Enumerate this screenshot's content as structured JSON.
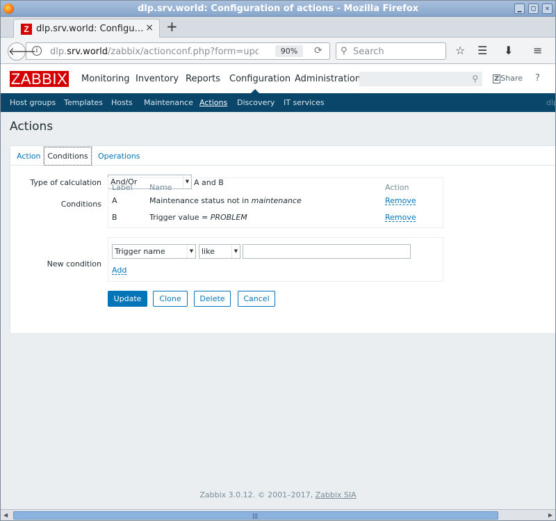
{
  "window": {
    "title": "dlp.srv.world: Configuration of actions - Mozilla Firefox",
    "btn_min": "▁",
    "btn_max": "□",
    "btn_close": "✕"
  },
  "browser": {
    "tab_title": "dlp.srv.world: Configu…",
    "tab_close": "×",
    "new_tab": "+",
    "url_host": "dlp.srv.world",
    "url_prefix": "dlp.",
    "url_domain": "srv.world",
    "url_path": "/zabbix/actionconf.php?form=upc",
    "zoom": "90%",
    "search_placeholder": "Search"
  },
  "zabbix": {
    "logo": "ZABBIX",
    "main_menu": [
      "Monitoring",
      "Inventory",
      "Reports",
      "Configuration",
      "Administration"
    ],
    "share": "Share",
    "help": "?",
    "sub_menu": [
      "Host groups",
      "Templates",
      "Hosts",
      "Maintenance",
      "Actions",
      "Discovery",
      "IT services"
    ],
    "sub_menu_right": "dlp",
    "page_title": "Actions",
    "tabs": [
      "Action",
      "Conditions",
      "Operations"
    ],
    "type_of_calc_label": "Type of calculation",
    "type_of_calc_value": "And/Or",
    "type_of_calc_expr": "A and B",
    "conditions_label": "Conditions",
    "cond_headers": {
      "label": "Label",
      "name": "Name",
      "action": "Action"
    },
    "conditions": [
      {
        "label": "A",
        "name": "Maintenance status not in ",
        "name_em": "maintenance",
        "action": "Remove"
      },
      {
        "label": "B",
        "name": "Trigger value = ",
        "name_em": "PROBLEM",
        "action": "Remove"
      }
    ],
    "new_condition_label": "New condition",
    "new_cond_type": "Trigger name",
    "new_cond_operator": "like",
    "new_cond_value": "",
    "add_link": "Add",
    "buttons": {
      "update": "Update",
      "clone": "Clone",
      "delete": "Delete",
      "cancel": "Cancel"
    },
    "footer_text": "Zabbix 3.0.12. © 2001–2017, ",
    "footer_link": "Zabbix SIA"
  },
  "colors": {
    "brand": "#d40000",
    "nav": "#0a466a",
    "link": "#0275b8"
  }
}
